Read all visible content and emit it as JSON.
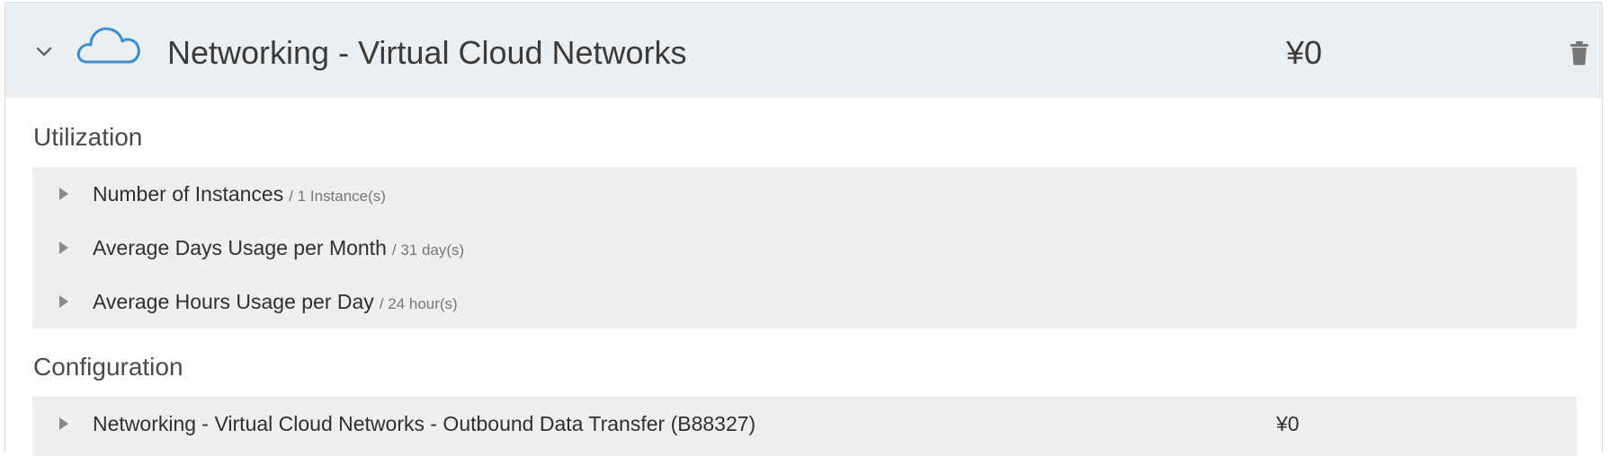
{
  "header": {
    "title": "Networking - Virtual Cloud Networks",
    "price": "¥0",
    "icon": "cloud-icon",
    "accent_color": "#3a8fd1"
  },
  "utilization": {
    "heading": "Utilization",
    "items": [
      {
        "label": "Number of Instances",
        "meta": "/ 1 Instance(s)"
      },
      {
        "label": "Average Days Usage per Month",
        "meta": "/ 31 day(s)"
      },
      {
        "label": "Average Hours Usage per Day",
        "meta": "/ 24 hour(s)"
      }
    ]
  },
  "configuration": {
    "heading": "Configuration",
    "items": [
      {
        "label": "Networking - Virtual Cloud Networks - Outbound Data Transfer (B88327)",
        "price": "¥0"
      }
    ]
  }
}
